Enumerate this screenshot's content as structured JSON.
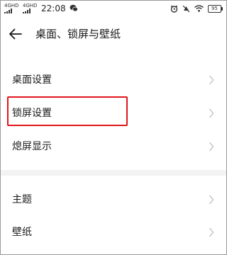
{
  "status_bar": {
    "sim1": "4G",
    "sim1_top": "4GHD",
    "sim2": "4G",
    "sim2_top": "4GHD",
    "time": "22:08",
    "battery": "95"
  },
  "header": {
    "title": "桌面、锁屏与壁纸"
  },
  "settings_group_1": [
    {
      "label": "桌面设置"
    },
    {
      "label": "锁屏设置"
    },
    {
      "label": "熄屏显示"
    }
  ],
  "settings_group_2": [
    {
      "label": "主题"
    },
    {
      "label": "壁纸"
    }
  ],
  "colors": {
    "highlight": "#e0161a",
    "divider": "#f3f3f3"
  }
}
